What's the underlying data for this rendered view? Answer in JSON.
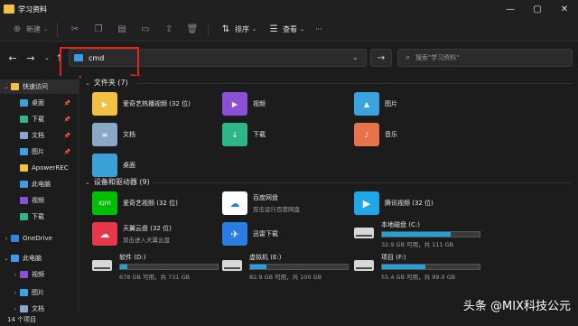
{
  "window": {
    "title": "学习资料"
  },
  "window_controls": [
    "—",
    "▢",
    "✕"
  ],
  "toolbar": {
    "new_label": "新建",
    "sort_label": "排序",
    "view_label": "查看",
    "more": "···"
  },
  "nav": {
    "back": "←",
    "forward": "→",
    "up": "↑",
    "dropdown": "⌄",
    "go": "→"
  },
  "address": {
    "value": "cmd"
  },
  "search": {
    "placeholder": "搜索\"学习资料\""
  },
  "sidebar": {
    "items": [
      {
        "label": "快速访问",
        "icon": "star-icon",
        "color": "#f2c144",
        "chev": "⌄"
      },
      {
        "label": "桌面",
        "icon": "desktop-icon",
        "color": "#3ba0d8",
        "pin": "📌"
      },
      {
        "label": "下载",
        "icon": "download-icon",
        "color": "#2fb58a",
        "pin": "📌"
      },
      {
        "label": "文档",
        "icon": "documents-icon",
        "color": "#8aa7c8",
        "pin": "📌"
      },
      {
        "label": "图片",
        "icon": "pictures-icon",
        "color": "#3aa3e0",
        "pin": "📌"
      },
      {
        "label": "ApowerREC",
        "icon": "folder-icon",
        "color": "#f2c144"
      },
      {
        "label": "此电脑",
        "icon": "pc-icon",
        "color": "#3b9be8"
      },
      {
        "label": "视频",
        "icon": "videos-icon",
        "color": "#8e4fd8"
      },
      {
        "label": "下载",
        "icon": "download-icon",
        "color": "#2fb58a"
      },
      {
        "label": "OneDrive",
        "icon": "cloud-icon",
        "color": "#2f87e8",
        "chev": "›"
      },
      {
        "label": "此电脑",
        "icon": "pc-icon",
        "color": "#3b9be8",
        "chev": "⌄"
      },
      {
        "label": "视频",
        "icon": "videos-icon",
        "color": "#8e4fd8",
        "chev": "›"
      },
      {
        "label": "图片",
        "icon": "pictures-icon",
        "color": "#3aa3e0",
        "chev": "›"
      },
      {
        "label": "文档",
        "icon": "documents-icon",
        "color": "#8aa7c8",
        "chev": "›"
      }
    ]
  },
  "folders_section": {
    "title": "文件夹 (7)"
  },
  "folders": [
    {
      "name": "爱奇艺热播视频 (32 位)",
      "icon": "iqiyi-folder-icon",
      "color": "#f2c144",
      "glyph": "▶"
    },
    {
      "name": "视频",
      "icon": "videos-folder-icon",
      "color": "#8e4fd8",
      "glyph": "▶"
    },
    {
      "name": "图片",
      "icon": "pictures-folder-icon",
      "color": "#3aa3e0",
      "glyph": "▲"
    },
    {
      "name": "文档",
      "icon": "documents-folder-icon",
      "color": "#8aa7c8",
      "glyph": "≡"
    },
    {
      "name": "下载",
      "icon": "downloads-folder-icon",
      "color": "#2fb58a",
      "glyph": "↓"
    },
    {
      "name": "音乐",
      "icon": "music-folder-icon",
      "color": "#e8734a",
      "glyph": "♪"
    },
    {
      "name": "桌面",
      "icon": "desktop-folder-icon",
      "color": "#3ba0d8",
      "glyph": ""
    }
  ],
  "devices_section": {
    "title": "设备和驱动器 (9)"
  },
  "apps": [
    {
      "name": "爱奇艺视频 (32 位)",
      "sub": "",
      "icon": "iqiyi-icon",
      "color": "#00be06",
      "glyph": "iQIYI"
    },
    {
      "name": "百度网盘",
      "sub": "双击运行百度网盘",
      "icon": "baidu-netdisk-icon",
      "color": "#ffffff",
      "glyph": "☁"
    },
    {
      "name": "腾讯视频 (32 位)",
      "sub": "",
      "icon": "tencent-video-icon",
      "color": "#1ea7e8",
      "glyph": "▶"
    },
    {
      "name": "天翼云盘 (32 位)",
      "sub": "双击进入天翼云盘",
      "icon": "tianyi-cloud-icon",
      "color": "#e8374a",
      "glyph": "☁"
    },
    {
      "name": "迅雷下载",
      "sub": "",
      "icon": "xunlei-icon",
      "color": "#2a7de1",
      "glyph": "✈"
    }
  ],
  "drives": [
    {
      "name": "本地磁盘 (C:)",
      "space": "32.9 GB 可用，共 111 GB",
      "used_percent": 70
    },
    {
      "name": "软件 (D:)",
      "space": "678 GB 可用，共 731 GB",
      "used_percent": 7
    },
    {
      "name": "虚拟机 (E:)",
      "space": "82.9 GB 可用，共 100 GB",
      "used_percent": 17
    },
    {
      "name": "项目 (F:)",
      "space": "55.4 GB 可用，共 99.0 GB",
      "used_percent": 44
    }
  ],
  "status": {
    "count": "14 个项目"
  },
  "watermark": {
    "text": "头条 @MIX科技公元"
  },
  "colors": {
    "highlight": "#e2261c",
    "drive_bar": "#26a0da"
  }
}
